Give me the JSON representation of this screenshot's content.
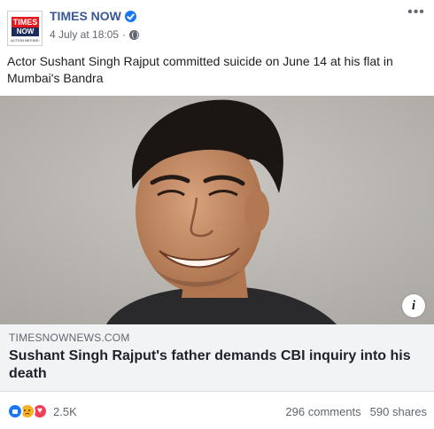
{
  "post": {
    "page_name": "TIMES NOW",
    "timestamp": "4 July at 18:05",
    "separator": "·",
    "text": "Actor Sushant Singh Rajput committed suicide on June 14 at his flat in Mumbai's Bandra",
    "logo": {
      "line1": "TIMES",
      "line2": "NOW",
      "line3": "ACTION BEGINS HERE"
    }
  },
  "link": {
    "domain": "TIMESNOWNEWS.COM",
    "title": "Sushant Singh Rajput's father demands CBI inquiry into his death",
    "info_glyph": "i"
  },
  "footer": {
    "reaction_count": "2.5K",
    "comments": "296 comments",
    "shares": "590 shares"
  },
  "icons": {
    "verified": "verified-badge-icon",
    "privacy": "globe-icon",
    "more": "more-options-icon",
    "reactions": [
      "like-icon",
      "sad-icon",
      "love-icon"
    ]
  },
  "colors": {
    "link_blue": "#385898",
    "fb_blue": "#1877f2",
    "logo_red": "#e4181c",
    "logo_navy": "#1d2b5e"
  }
}
